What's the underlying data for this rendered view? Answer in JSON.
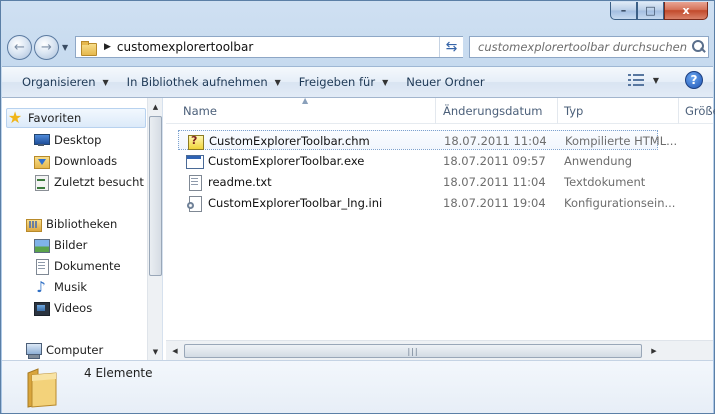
{
  "window": {
    "minimize_label": "–",
    "maximize_label": "□",
    "close_label": "x"
  },
  "address": {
    "back_label": "←",
    "forward_label": "→",
    "path": "customexplorertoolbar",
    "refresh_label": "⇆"
  },
  "search": {
    "placeholder": "customexplorertoolbar durchsuchen"
  },
  "toolbar": {
    "items": [
      "Organisieren",
      "In Bibliothek aufnehmen",
      "Freigeben für",
      "Neuer Ordner"
    ],
    "help_label": "?"
  },
  "nav": {
    "favorites": "Favoriten",
    "favorites_items": [
      "Desktop",
      "Downloads",
      "Zuletzt besucht"
    ],
    "libraries": "Bibliotheken",
    "libraries_items": [
      "Bilder",
      "Dokumente",
      "Musik",
      "Videos"
    ],
    "computer": "Computer"
  },
  "columns": [
    "Name",
    "Änderungsdatum",
    "Typ",
    "Größe"
  ],
  "files": [
    {
      "name": "CustomExplorerToolbar.chm",
      "date": "18.07.2011 11:04",
      "type": "Kompilierte HTML...",
      "icon": "help-file-icon"
    },
    {
      "name": "CustomExplorerToolbar.exe",
      "date": "18.07.2011 09:57",
      "type": "Anwendung",
      "icon": "application-icon"
    },
    {
      "name": "readme.txt",
      "date": "18.07.2011 11:04",
      "type": "Textdokument",
      "icon": "text-file-icon"
    },
    {
      "name": "CustomExplorerToolbar_lng.ini",
      "date": "18.07.2011 19:04",
      "type": "Konfigurationsein...",
      "icon": "settings-file-icon"
    }
  ],
  "details": {
    "count": "4 Elemente"
  }
}
